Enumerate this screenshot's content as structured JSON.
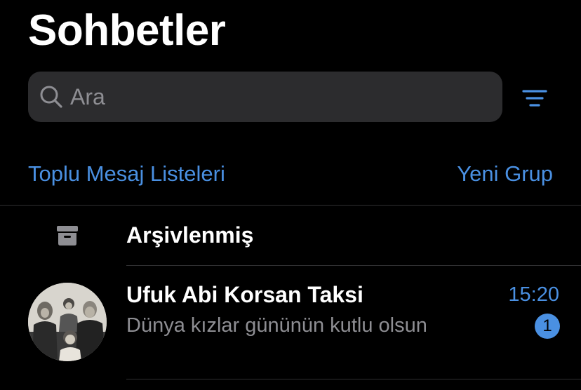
{
  "header": {
    "title": "Sohbetler"
  },
  "search": {
    "placeholder": "Ara",
    "value": ""
  },
  "actions": {
    "broadcast_lists": "Toplu Mesaj Listeleri",
    "new_group": "Yeni Grup"
  },
  "archived": {
    "label": "Arşivlenmiş",
    "icon": "archive-icon"
  },
  "chats": [
    {
      "name": "Ufuk Abi Korsan Taksi",
      "preview": "Dünya kızlar gününün kutlu olsun",
      "time": "15:20",
      "unread": "1"
    }
  ],
  "colors": {
    "background": "#000000",
    "search_bg": "#2c2c2e",
    "accent": "#4a90e2",
    "secondary_text": "#8e8e93",
    "divider": "#2f2f31"
  }
}
